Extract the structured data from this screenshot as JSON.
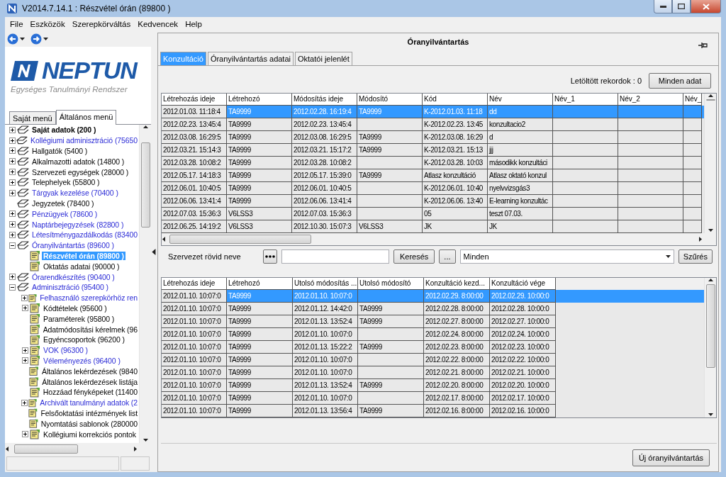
{
  "window": {
    "title": "V2014.7.14.1 : Részvétel órán (89800 )"
  },
  "menu": [
    "File",
    "Eszközök",
    "Szerepkörváltás",
    "Kedvencek",
    "Help"
  ],
  "logo": {
    "name": "NEPTUN",
    "tagline": "Egységes Tanulmányi Rendszer"
  },
  "menu_tabs": [
    {
      "label": "Saját menü",
      "selected": false
    },
    {
      "label": "Általános menü",
      "selected": true
    }
  ],
  "tree": [
    {
      "label": "Saját adatok (200 )",
      "expanded": false,
      "kind": "book",
      "link": false,
      "bold": true,
      "selected": false
    },
    {
      "label": "Kollégiumi adminisztráció (75650",
      "expanded": false,
      "kind": "book",
      "link": true,
      "selected": false
    },
    {
      "label": "Hallgatók (5400 )",
      "expanded": false,
      "kind": "book",
      "link": false,
      "selected": false
    },
    {
      "label": "Alkalmazotti adatok (14800 )",
      "expanded": false,
      "kind": "book",
      "link": false,
      "selected": false
    },
    {
      "label": "Szervezeti egységek (28000 )",
      "expanded": false,
      "kind": "book",
      "link": false,
      "selected": false
    },
    {
      "label": "Telephelyek (55800 )",
      "expanded": false,
      "kind": "book",
      "link": false,
      "selected": false
    },
    {
      "label": "Tárgyak kezelése (70400 )",
      "expanded": false,
      "kind": "book",
      "link": true,
      "selected": false
    },
    {
      "label": "Jegyzetek (78400 )",
      "kind": "book",
      "link": false,
      "selected": false
    },
    {
      "label": "Pénzügyek (78600 )",
      "expanded": false,
      "kind": "book",
      "link": true,
      "selected": false
    },
    {
      "label": "Naptárbejegyzések (82800 )",
      "expanded": false,
      "kind": "book",
      "link": true,
      "selected": false
    },
    {
      "label": "Létesítménygazdálkodás (83400",
      "expanded": false,
      "kind": "book",
      "link": true,
      "selected": false
    },
    {
      "label": "Óranyilvántartás (89600 )",
      "expanded": true,
      "kind": "book",
      "link": true,
      "selected": false,
      "children": [
        {
          "label": "Részvétel órán (89800 )",
          "kind": "page",
          "link": false,
          "bold": true,
          "selected": true
        },
        {
          "label": "Oktatás adatai (90000 )",
          "kind": "page",
          "link": false,
          "selected": false
        }
      ]
    },
    {
      "label": "Órarendkészítés (90400 )",
      "expanded": false,
      "kind": "book",
      "link": true,
      "selected": false
    },
    {
      "label": "Adminisztráció (95400 )",
      "expanded": true,
      "kind": "book",
      "link": true,
      "selected": false,
      "children": [
        {
          "label": "Felhasználó szerepkörhöz ren",
          "expanded": false,
          "kind": "page",
          "link": true,
          "selected": false
        },
        {
          "label": "Kódtételek (95600 )",
          "expanded": false,
          "kind": "page",
          "link": false,
          "selected": false
        },
        {
          "label": "Paraméterek (95800 )",
          "kind": "page",
          "link": false,
          "selected": false
        },
        {
          "label": "Adatmódosítási kérelmek (96",
          "kind": "page",
          "link": false,
          "selected": false
        },
        {
          "label": "Egyéncsoportok (96200 )",
          "kind": "page",
          "link": false,
          "selected": false
        },
        {
          "label": "VOK (96300 )",
          "expanded": false,
          "kind": "page",
          "link": true,
          "selected": false
        },
        {
          "label": "Véleményezés (96400 )",
          "expanded": false,
          "kind": "page",
          "link": true,
          "selected": false
        },
        {
          "label": "Általános lekérdezések (9840",
          "kind": "page",
          "link": false,
          "selected": false
        },
        {
          "label": "Általános lekérdezések listája",
          "kind": "page",
          "link": false,
          "selected": false
        },
        {
          "label": "Hozzáad fényképeket (11400",
          "kind": "page",
          "link": false,
          "selected": false
        },
        {
          "label": "Archivált tanulmányi adatok (2",
          "expanded": false,
          "kind": "page",
          "link": true,
          "selected": false
        },
        {
          "label": "Felsőoktatási intézmények list",
          "kind": "page",
          "link": false,
          "selected": false
        },
        {
          "label": "Nyomtatási sablonok (280000",
          "kind": "page",
          "link": false,
          "selected": false
        },
        {
          "label": "Kollégiumi korrekciós pontok",
          "expanded": false,
          "kind": "page",
          "link": false,
          "selected": false
        }
      ]
    }
  ],
  "panel": {
    "title": "Óranyilvántartás"
  },
  "tabs": [
    {
      "label": "Konzultáció",
      "selected": true
    },
    {
      "label": "Óranyilvántartás adatai",
      "selected": false
    },
    {
      "label": "Oktatói jelenlét",
      "selected": false
    }
  ],
  "records": {
    "label": "Letöltött rekordok : 0",
    "button": "Minden adat"
  },
  "top_table": {
    "columns": [
      "Létrehozás ideje",
      "Létrehozó",
      "Módosítás ideje",
      "Módosító",
      "Kód",
      "Név",
      "Név_1",
      "Név_2",
      "Név_"
    ],
    "rows": [
      {
        "selected": true,
        "cells": [
          "2012.01.03. 11:18:4",
          "TA9999",
          "2012.02.28. 16:19:4",
          "TA9999",
          "K-2012.01.03. 11:18",
          "dd"
        ]
      },
      {
        "selected": false,
        "cells": [
          "2012.02.23. 13:45:4",
          "TA9999",
          "2012.02.23. 13:45:4",
          null,
          "K-2012.02.23. 13:45",
          "konzultacio2"
        ]
      },
      {
        "selected": false,
        "cells": [
          "2012.03.08. 16:29:5",
          "TA9999",
          "2012.03.08. 16:29:5",
          "TA9999",
          "K-2012.03.08. 16:29",
          "d"
        ]
      },
      {
        "selected": false,
        "cells": [
          "2012.03.21. 15:14:3",
          "TA9999",
          "2012.03.21. 15:17:2",
          "TA9999",
          "K-2012.03.21. 15:13",
          "jjj"
        ]
      },
      {
        "selected": false,
        "cells": [
          "2012.03.28. 10:08:2",
          "TA9999",
          "2012.03.28. 10:08:2",
          null,
          "K-2012.03.28. 10:03",
          "másodikk konzultáci"
        ]
      },
      {
        "selected": false,
        "cells": [
          "2012.05.17. 14:18:3",
          "TA9999",
          "2012.05.17. 15:39:0",
          "TA9999",
          "Atlasz konzultáció",
          "Atlasz oktató konzul"
        ]
      },
      {
        "selected": false,
        "cells": [
          "2012.06.01. 10:40:5",
          "TA9999",
          "2012.06.01. 10:40:5",
          null,
          "K-2012.06.01. 10:40",
          "nyelvvizsgás3"
        ]
      },
      {
        "selected": false,
        "cells": [
          "2012.06.06. 13:41:4",
          "TA9999",
          "2012.06.06. 13:41:4",
          null,
          "K-2012.06.06. 13:40",
          "E-learning konzultác"
        ]
      },
      {
        "selected": false,
        "cells": [
          "2012.07.03. 15:36:3",
          "V6LSS3",
          "2012.07.03. 15:36:3",
          null,
          "05",
          "teszt 07.03."
        ]
      },
      {
        "selected": false,
        "cells": [
          "2012.06.25. 14:19:2",
          "V6LSS3",
          "2012.10.30. 15:07:3",
          "V6LSS3",
          "JK",
          "JK"
        ]
      }
    ]
  },
  "filter": {
    "label": "Szervezet rövid neve",
    "browse_button": "...",
    "search_button": "Keresés",
    "select_value": "Minden",
    "filter_button": "Szűrés"
  },
  "bottom_table": {
    "columns": [
      "Létrehozás ideje",
      "Létrehozó",
      "Utolsó módosítás ...",
      "Utolsó módosító",
      "Konzultáció kezd...",
      "Konzultáció vége"
    ],
    "rows": [
      {
        "selected": true,
        "cells": [
          "2012.01.10. 10:07:0",
          "TA9999",
          "2012.01.10. 10:07:0",
          null,
          "2012.02.29. 8:00:00",
          "2012.02.29. 10:00:0"
        ]
      },
      {
        "selected": false,
        "cells": [
          "2012.01.10. 10:07:0",
          "TA9999",
          "2012.01.12. 14:42:0",
          "TA9999",
          "2012.02.28. 8:00:00",
          "2012.02.28. 10:00:0"
        ]
      },
      {
        "selected": false,
        "cells": [
          "2012.01.10. 10:07:0",
          "TA9999",
          "2012.01.13. 13:52:4",
          "TA9999",
          "2012.02.27. 8:00:00",
          "2012.02.27. 10:00:0"
        ]
      },
      {
        "selected": false,
        "cells": [
          "2012.01.10. 10:07:0",
          "TA9999",
          "2012.01.10. 10:07:0",
          null,
          "2012.02.24. 8:00:00",
          "2012.02.24. 10:00:0"
        ]
      },
      {
        "selected": false,
        "cells": [
          "2012.01.10. 10:07:0",
          "TA9999",
          "2012.01.13. 15:22:2",
          "TA9999",
          "2012.02.23. 8:00:00",
          "2012.02.23. 10:00:0"
        ]
      },
      {
        "selected": false,
        "cells": [
          "2012.01.10. 10:07:0",
          "TA9999",
          "2012.01.10. 10:07:0",
          null,
          "2012.02.22. 8:00:00",
          "2012.02.22. 10:00:0"
        ]
      },
      {
        "selected": false,
        "cells": [
          "2012.01.10. 10:07:0",
          "TA9999",
          "2012.01.10. 10:07:0",
          null,
          "2012.02.21. 8:00:00",
          "2012.02.21. 10:00:0"
        ]
      },
      {
        "selected": false,
        "cells": [
          "2012.01.10. 10:07:0",
          "TA9999",
          "2012.01.13. 13:52:4",
          "TA9999",
          "2012.02.20. 8:00:00",
          "2012.02.20. 10:00:0"
        ]
      },
      {
        "selected": false,
        "cells": [
          "2012.01.10. 10:07:0",
          "TA9999",
          "2012.01.10. 10:07:0",
          null,
          "2012.02.17. 8:00:00",
          "2012.02.17. 10:00:0"
        ]
      },
      {
        "selected": false,
        "cells": [
          "2012.01.10. 10:07:0",
          "TA9999",
          "2012.01.13. 13:56:4",
          "TA9999",
          "2012.02.16. 8:00:00",
          "2012.02.16. 10:00:0"
        ]
      }
    ]
  },
  "footer": {
    "button": "Új óranyilvántartás"
  }
}
